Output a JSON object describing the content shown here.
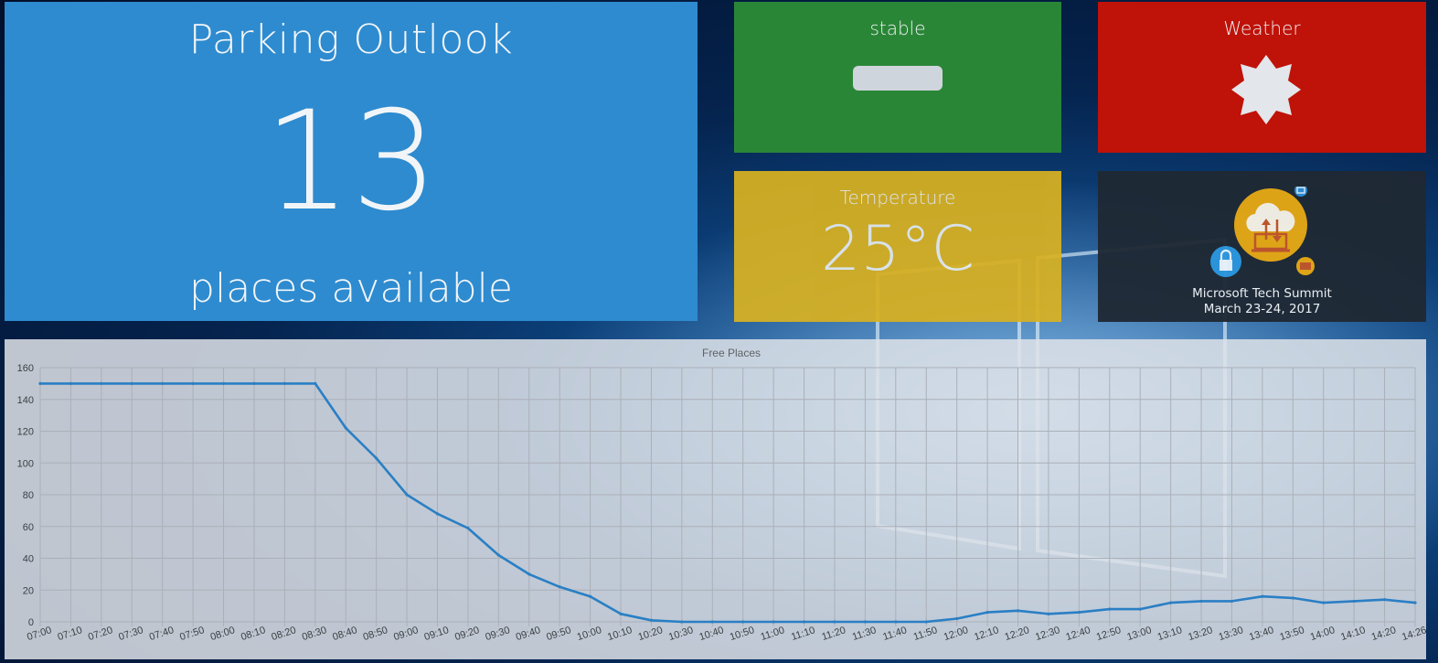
{
  "parking": {
    "title": "Parking Outlook",
    "count": "13",
    "footer": "places available"
  },
  "trend": {
    "label": "stable",
    "icon": "stable-bar-icon"
  },
  "weather": {
    "label": "Weather",
    "icon": "sun-icon"
  },
  "temperature": {
    "label": "Temperature",
    "value": "25°C"
  },
  "event": {
    "line1": "Microsoft Tech Summit",
    "line2": "March 23-24, 2017",
    "icon": "tech-summit-cloud-icon"
  },
  "colors": {
    "parking_tile": "#2e8bcf",
    "trend_tile": "#2a8637",
    "weather_tile": "#bf1208",
    "temperature_tile": "#d8b121",
    "event_tile": "#1f2934",
    "series_line": "#2a7fc4"
  },
  "chart_data": {
    "type": "line",
    "title": "Free Places",
    "xlabel": "",
    "ylabel": "",
    "ylim": [
      0,
      160
    ],
    "yticks": [
      0,
      20,
      40,
      60,
      80,
      100,
      120,
      140,
      160
    ],
    "categories": [
      "07:00",
      "07:10",
      "07:20",
      "07:30",
      "07:40",
      "07:50",
      "08:00",
      "08:10",
      "08:20",
      "08:30",
      "08:40",
      "08:50",
      "09:00",
      "09:10",
      "09:20",
      "09:30",
      "09:40",
      "09:50",
      "10:00",
      "10:10",
      "10:20",
      "10:30",
      "10:40",
      "10:50",
      "11:00",
      "11:10",
      "11:20",
      "11:30",
      "11:40",
      "11:50",
      "12:00",
      "12:10",
      "12:20",
      "12:30",
      "12:40",
      "12:50",
      "13:00",
      "13:10",
      "13:20",
      "13:30",
      "13:40",
      "13:50",
      "14:00",
      "14:10",
      "14:20",
      "14:26"
    ],
    "grid": true,
    "legend": "none",
    "series": [
      {
        "values": [
          150,
          150,
          150,
          150,
          150,
          150,
          150,
          150,
          150,
          150,
          122,
          103,
          80,
          68,
          59,
          42,
          30,
          22,
          16,
          5,
          1,
          0,
          0,
          0,
          0,
          0,
          0,
          0,
          0,
          0,
          2,
          6,
          7,
          5,
          6,
          8,
          8,
          12,
          13,
          13,
          16,
          15,
          12,
          13,
          14,
          12
        ]
      }
    ]
  }
}
